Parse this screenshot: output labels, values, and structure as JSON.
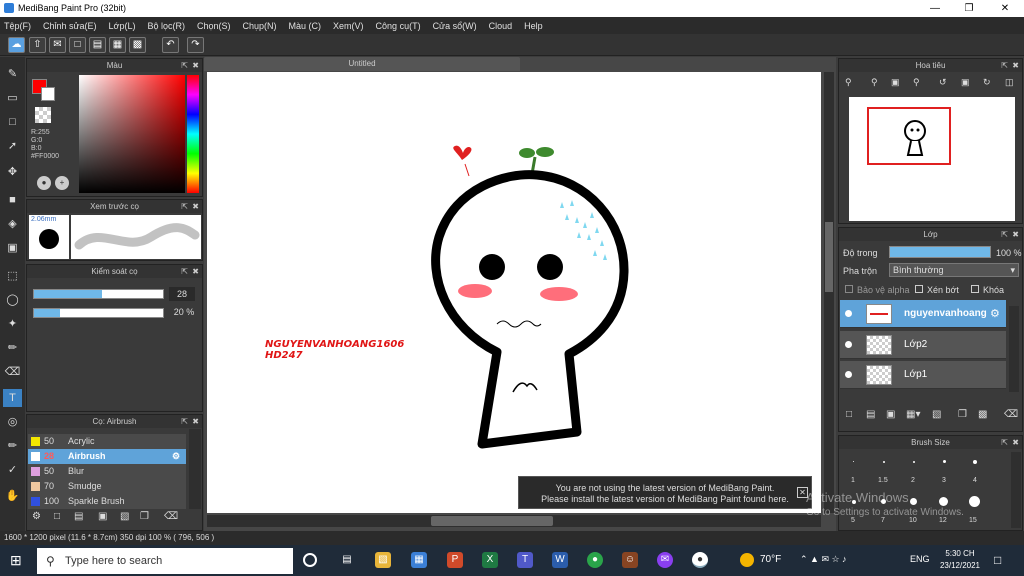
{
  "window": {
    "title": "MediBang Paint Pro (32bit)"
  },
  "menu": [
    "Tệp(F)",
    "Chỉnh sửa(E)",
    "Lớp(L)",
    "Bộ lọc(R)",
    "Chọn(S)",
    "Chụp(N)",
    "Màu (C)",
    "Xem(V)",
    "Công cụ(T)",
    "Cửa sổ(W)",
    "Cloud",
    "Help"
  ],
  "color_panel": {
    "title": "Màu",
    "r": "R:255",
    "g": "G:0",
    "b": "B:0",
    "hex": "#FF0000",
    "primary": "#ff0000"
  },
  "brush_preview": {
    "title": "Xem trước cọ",
    "size": "2.06mm"
  },
  "brush_control": {
    "title": "Kiểm soát cọ",
    "size_value": "28",
    "opacity_value": "20 %",
    "size_fraction": 0.53,
    "opacity_fraction": 0.2
  },
  "brush_list": {
    "title": "Cọ: Airbrush",
    "items": [
      {
        "size": "50",
        "name": "Acrylic",
        "color": "#f2e600"
      },
      {
        "size": "28",
        "name": "Airbrush",
        "color": "#ffffff",
        "selected": true
      },
      {
        "size": "50",
        "name": "Blur",
        "color": "#e0a0e0"
      },
      {
        "size": "70",
        "name": "Smudge",
        "color": "#f0c8a0"
      },
      {
        "size": "100",
        "name": "Sparkle Brush",
        "color": "#3050e0"
      }
    ]
  },
  "canvas": {
    "tab": "Untitled",
    "signature_line1": "NGUYENVANHOANG1606",
    "signature_line2": "HD247"
  },
  "notice": {
    "line1": "You are not using the latest version of MediBang Paint.",
    "line2": "Please install the latest version of MediBang Paint found here."
  },
  "navigator": {
    "title": "Hoa tiêu"
  },
  "layers": {
    "title": "Lớp",
    "opacity_label": "Độ trong",
    "opacity_value": "100 %",
    "blend_label": "Pha trộn",
    "blend_value": "Bình thường",
    "protect_alpha": "Bảo vệ alpha",
    "clipping": "Xén bớt",
    "lock": "Khóa",
    "items": [
      {
        "name": "nguyenvanhoang",
        "selected": true
      },
      {
        "name": "Lớp2"
      },
      {
        "name": "Lớp1"
      }
    ]
  },
  "brush_size_panel": {
    "title": "Brush Size",
    "sizes": [
      "1",
      "1.5",
      "2",
      "3",
      "4",
      "5",
      "7",
      "10",
      "12",
      "15"
    ]
  },
  "watermark": {
    "line1": "Activate Windows",
    "line2": "Go to Settings to activate Windows."
  },
  "status": {
    "text": "1600 * 1200 pixel   (11.6 * 8.7cm)   350 dpi   100 %   ( 796, 506 )"
  },
  "taskbar": {
    "search_placeholder": "Type here to search",
    "weather": "70°F",
    "lang": "ENG",
    "time": "5:30 CH",
    "date": "23/12/2021"
  }
}
